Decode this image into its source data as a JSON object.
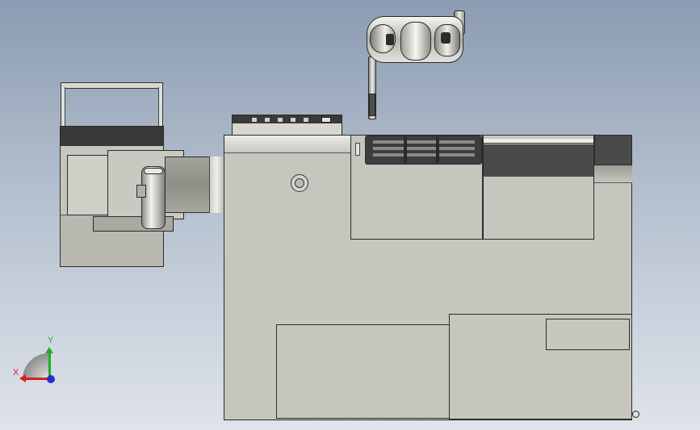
{
  "viewport": {
    "background_top": "#8c9bb2",
    "background_bottom": "#dfe3ea"
  },
  "model": {
    "body_color": "#c6c6be",
    "dark_band_color": "#3a3a3a",
    "edge_color": "#2b2b2b",
    "chrome_color": "#e8e8e8"
  },
  "triad": {
    "x_label": "X",
    "y_label": "Y",
    "x_color": "#d42020",
    "y_color": "#20b020",
    "z_color": "#2030d0",
    "icons": [
      "coordinate-triad-icon"
    ]
  }
}
